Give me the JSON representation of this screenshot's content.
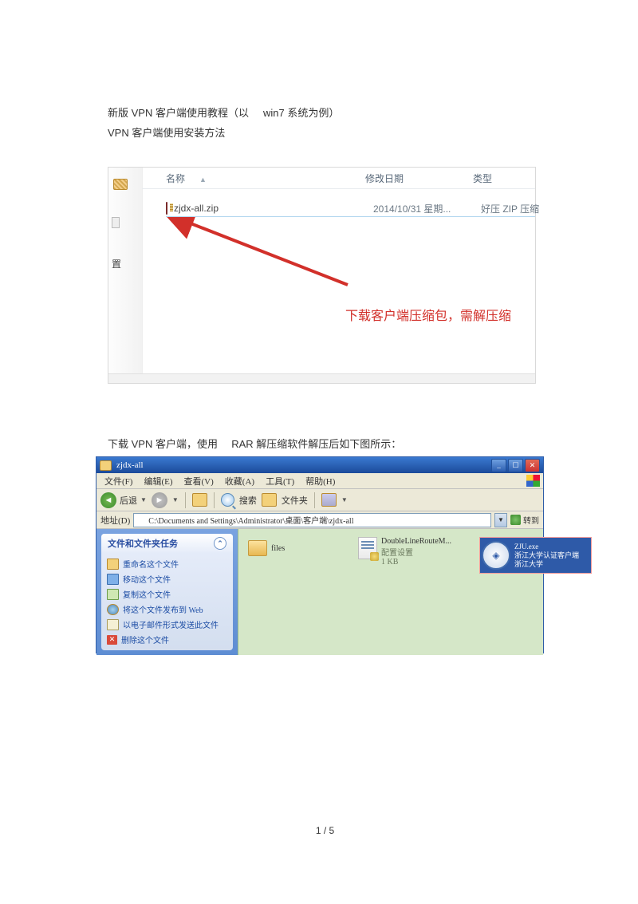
{
  "intro": {
    "line1_a": "新版 VPN 客户端使用教程（以",
    "line1_b": "win7  系统为例）",
    "line2": "VPN 客户端使用安装方法"
  },
  "shot1": {
    "headers": {
      "name": "名称",
      "date": "修改日期",
      "type": "类型"
    },
    "row": {
      "filename": "zjdx-all.zip",
      "date": "2014/10/31 星期...",
      "type": "好压 ZIP 压缩"
    },
    "note": "下载客户端压缩包，需解压缩",
    "side_char": "置"
  },
  "mid_caption": {
    "a": "下载 VPN 客户端，使用",
    "b": "RAR 解压缩软件解压后如下图所示："
  },
  "xp": {
    "title": "zjdx-all",
    "menus": [
      "文件(F)",
      "编辑(E)",
      "查看(V)",
      "收藏(A)",
      "工具(T)",
      "帮助(H)"
    ],
    "tool_back": "后退",
    "tool_search": "搜索",
    "tool_folders": "文件夹",
    "addr_label": "地址(D)",
    "addr_path": "C:\\Documents and Settings\\Administrator\\桌面\\客户端\\zjdx-all",
    "go": "转到",
    "panel_header": "文件和文件夹任务",
    "tasks": [
      "重命名这个文件",
      "移动这个文件",
      "复制这个文件",
      "将这个文件发布到 Web",
      "以电子邮件形式发送此文件",
      "删除这个文件"
    ],
    "files": {
      "folder": "files",
      "ini_name": "DoubleLineRouteM...",
      "ini_desc": "配置设置",
      "ini_size": "1 KB",
      "zju_l1": "ZJU.exe",
      "zju_l2": "浙江大学认证客户端",
      "zju_l3": "浙江大学"
    }
  },
  "page_num": "1 / 5"
}
